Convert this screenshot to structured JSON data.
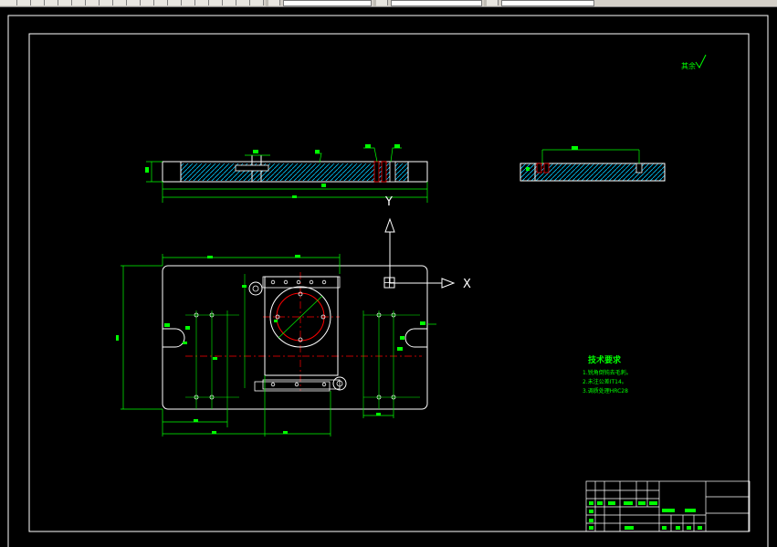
{
  "toolbar": {
    "field_1": "",
    "field_2": "",
    "field_3": ""
  },
  "ucs": {
    "x_label": "X",
    "y_label": "Y"
  },
  "notes": {
    "roughness": "其余",
    "tech_title": "技术要求",
    "tech_lines": [
      "1.锐角倒钝去毛刺。",
      "2.未注公差IT14。",
      "3.调质处理HRC28"
    ]
  },
  "colors": {
    "background": "#000000",
    "frame": "#ffffff",
    "geometry": "#ffffff",
    "dimension": "#00ff00",
    "center_line": "#ff0000",
    "hatch": "#00c8ff"
  }
}
